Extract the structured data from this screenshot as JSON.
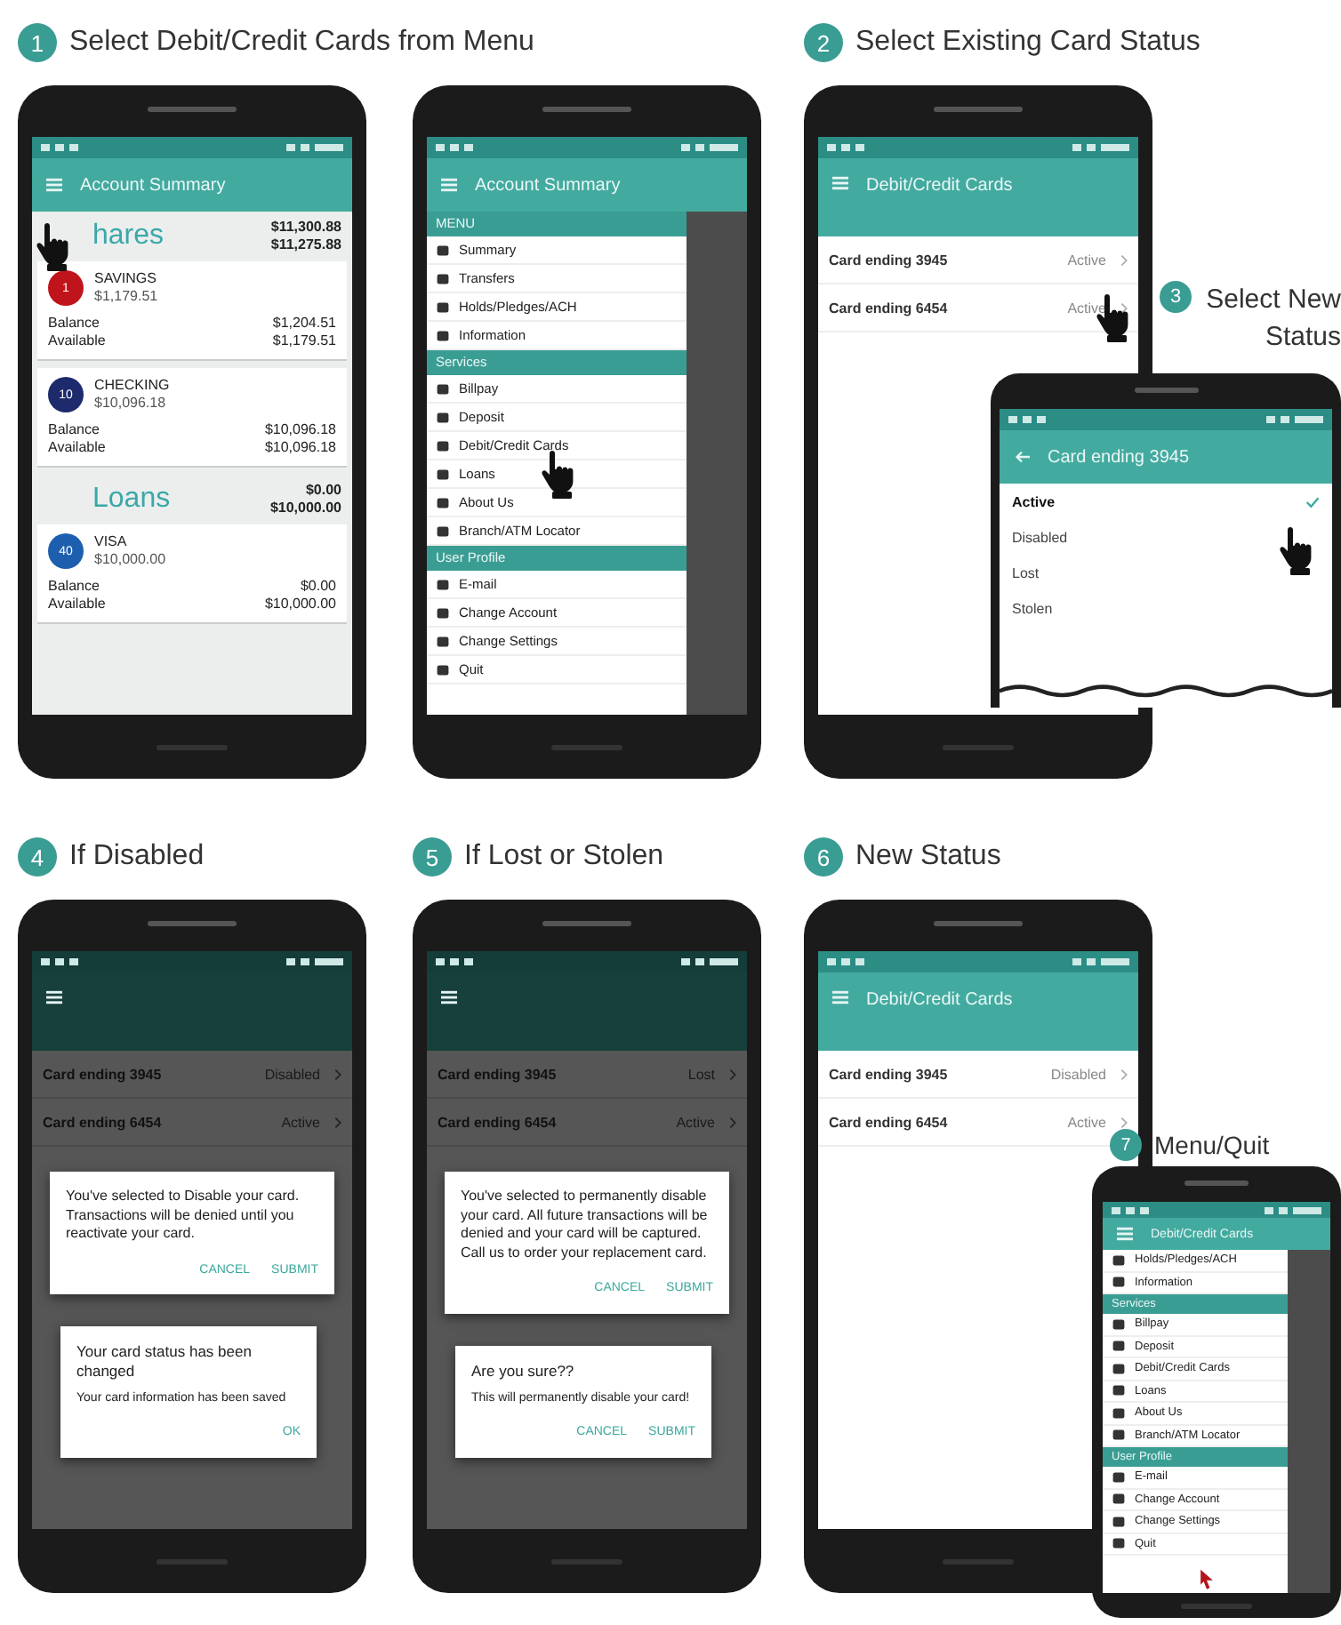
{
  "panels": [
    {
      "step": {
        "number": "1",
        "title": "Select Debit/Credit Cards from Menu"
      },
      "screen": {
        "kind": "summary",
        "title": "Account Summary",
        "groups": [
          {
            "name": "hares",
            "total": "$11,300.88",
            "available": "$11,275.88",
            "accounts": [
              {
                "badge": "1",
                "color": "#c0141c",
                "name": "SAVINGS",
                "amount": "$1,179.51",
                "lines": [
                  {
                    "label": "Balance",
                    "value": "$1,204.51"
                  },
                  {
                    "label": "Available",
                    "value": "$1,179.51"
                  }
                ]
              },
              {
                "badge": "10",
                "color": "#1d2a6b",
                "name": "CHECKING",
                "amount": "$10,096.18",
                "lines": [
                  {
                    "label": "Balance",
                    "value": "$10,096.18"
                  },
                  {
                    "label": "Available",
                    "value": "$10,096.18"
                  }
                ]
              }
            ]
          },
          {
            "name": "Loans",
            "total": "$0.00",
            "available": "$10,000.00",
            "accounts": [
              {
                "badge": "40",
                "color": "#1d5fae",
                "name": "VISA",
                "amount": "$10,000.00",
                "lines": [
                  {
                    "label": "Balance",
                    "value": "$0.00"
                  },
                  {
                    "label": "Available",
                    "value": "$10,000.00"
                  }
                ]
              }
            ]
          }
        ]
      }
    },
    {
      "screen": {
        "kind": "menu",
        "title": "Account Summary",
        "sections": [
          {
            "name": "MENU",
            "items": [
              "Summary",
              "Transfers",
              "Holds/Pledges/ACH",
              "Information"
            ]
          },
          {
            "name": "Services",
            "items": [
              "Billpay",
              "Deposit",
              "Debit/Credit Cards",
              "Loans",
              "About Us",
              "Branch/ATM Locator"
            ]
          },
          {
            "name": "User Profile",
            "items": [
              "E-mail",
              "Change Account",
              "Change Settings",
              "Quit"
            ]
          }
        ]
      }
    },
    {
      "step": {
        "number": "2",
        "title": "Select Existing Card Status"
      },
      "screen": {
        "kind": "cards",
        "title": "Debit/Credit Cards",
        "cards": [
          {
            "name": "Card ending 3945",
            "status": "Active"
          },
          {
            "name": "Card ending 6454",
            "status": "Active"
          }
        ]
      }
    },
    {
      "step": {
        "number": "3",
        "title": "Select New Status"
      },
      "screen": {
        "kind": "options",
        "title": "Card ending 3945",
        "options": [
          {
            "label": "Active",
            "selected": true
          },
          {
            "label": "Disabled",
            "selected": false
          },
          {
            "label": "Lost",
            "selected": false
          },
          {
            "label": "Stolen",
            "selected": false
          }
        ]
      }
    },
    {
      "step": {
        "number": "4",
        "title": "If Disabled"
      },
      "screen": {
        "kind": "dialogs",
        "cards": [
          {
            "name": "Card ending 3945",
            "status": "Disabled"
          },
          {
            "name": "Card ending 6454",
            "status": "Active"
          }
        ],
        "dialogs": [
          {
            "message": "You've selected to Disable your card.  Transactions will be denied until you reactivate your card.",
            "actions": [
              "CANCEL",
              "SUBMIT"
            ]
          },
          {
            "title": "Your card status has been changed",
            "message": "Your card information has been saved",
            "actions": [
              "OK"
            ]
          }
        ]
      }
    },
    {
      "step": {
        "number": "5",
        "title": "If Lost or Stolen"
      },
      "screen": {
        "kind": "dialogs",
        "cards": [
          {
            "name": "Card ending 3945",
            "status": "Lost"
          },
          {
            "name": "Card ending 6454",
            "status": "Active"
          }
        ],
        "dialogs": [
          {
            "message": "You've selected to permanently disable your card.  All future transactions will be denied and your card will be captured.  Call us to order your replacement card.",
            "actions": [
              "CANCEL",
              "SUBMIT"
            ]
          },
          {
            "title": "Are you sure??",
            "message": "This will permanently disable your card!",
            "actions": [
              "CANCEL",
              "SUBMIT"
            ]
          }
        ]
      }
    },
    {
      "step": {
        "number": "6",
        "title": "New Status"
      },
      "screen": {
        "kind": "cards",
        "title": "Debit/Credit Cards",
        "cards": [
          {
            "name": "Card ending 3945",
            "status": "Disabled"
          },
          {
            "name": "Card ending 6454",
            "status": "Active"
          }
        ]
      }
    },
    {
      "step": {
        "number": "7",
        "title": "Menu/Quit"
      },
      "screen": {
        "kind": "menu",
        "title": "Debit/Credit Cards",
        "sections": [
          {
            "items": [
              "Holds/Pledges/ACH",
              "Information"
            ]
          },
          {
            "name": "Services",
            "items": [
              "Billpay",
              "Deposit",
              "Debit/Credit Cards",
              "Loans",
              "About Us",
              "Branch/ATM Locator"
            ]
          },
          {
            "name": "User Profile",
            "items": [
              "E-mail",
              "Change Account",
              "Change Settings",
              "Quit"
            ]
          }
        ]
      }
    }
  ]
}
